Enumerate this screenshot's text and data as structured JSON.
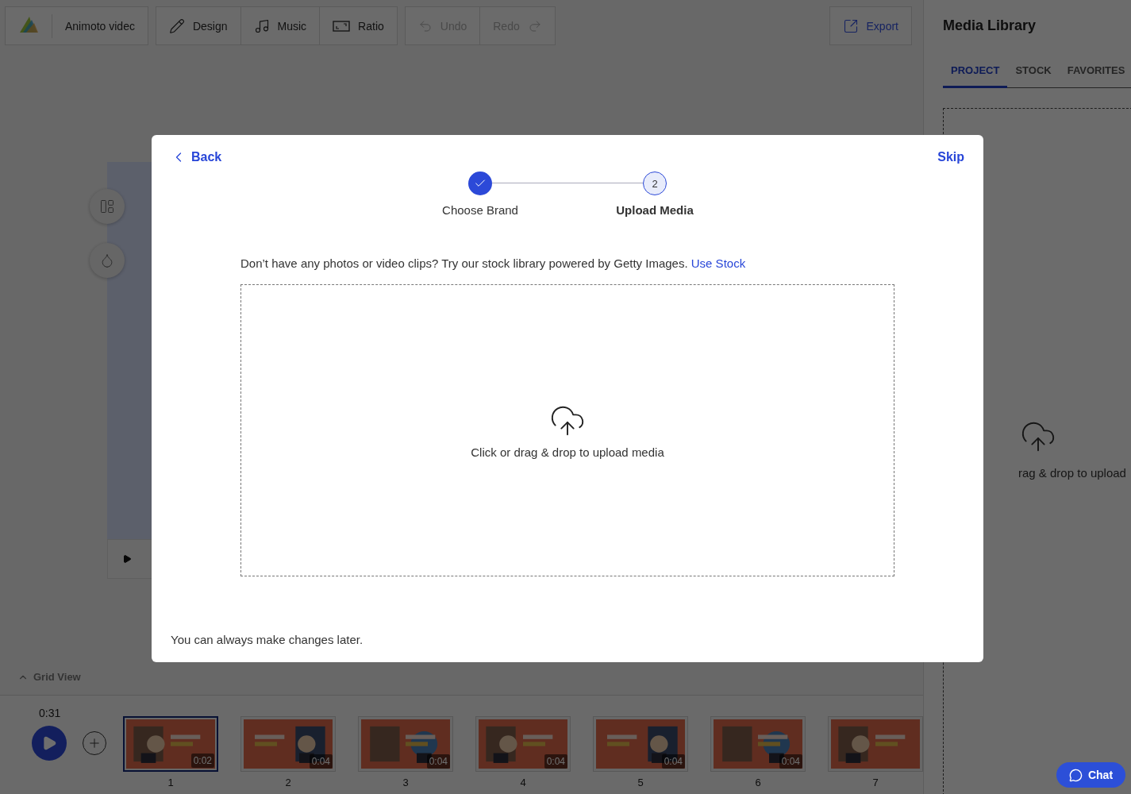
{
  "toolbar": {
    "project_title": "Animoto videc",
    "tools": [
      {
        "label": "Design",
        "kind": "design"
      },
      {
        "label": "Music",
        "kind": "music"
      },
      {
        "label": "Ratio",
        "kind": "ratio"
      }
    ],
    "history": [
      {
        "label": "Undo",
        "kind": "undo",
        "disabled": true
      },
      {
        "label": "Redo",
        "kind": "redo",
        "disabled": true
      }
    ],
    "export": "Export"
  },
  "timeline": {
    "grid_view": "Grid View",
    "total_time": "0:31",
    "clips": [
      {
        "number": "1",
        "duration": "0:02",
        "selected": true
      },
      {
        "number": "2",
        "duration": "0:04",
        "selected": false
      },
      {
        "number": "3",
        "duration": "0:04",
        "selected": false
      },
      {
        "number": "4",
        "duration": "0:04",
        "selected": false
      },
      {
        "number": "5",
        "duration": "0:04",
        "selected": false
      },
      {
        "number": "6",
        "duration": "0:04",
        "selected": false
      },
      {
        "number": "7",
        "selected": false
      }
    ]
  },
  "media_library": {
    "title": "Media Library",
    "tabs": [
      {
        "label": "PROJECT",
        "selected": true
      },
      {
        "label": "STOCK",
        "selected": false
      },
      {
        "label": "FAVORITES",
        "selected": false
      }
    ],
    "dropzone_text": "rag & drop to upload"
  },
  "modal": {
    "back": "Back",
    "skip": "Skip",
    "steps": [
      {
        "label": "Choose Brand",
        "done": true,
        "selected": false
      },
      {
        "label": "Upload Media",
        "number": "2",
        "done": false,
        "selected": true
      }
    ],
    "stock_prompt": "Don’t have any photos or video clips? Try our stock library powered by Getty Images.",
    "stock_link": "Use Stock",
    "dropzone_text": "Click or drag & drop to upload media",
    "footer_note": "You can always make changes later."
  },
  "chat": "Chat"
}
